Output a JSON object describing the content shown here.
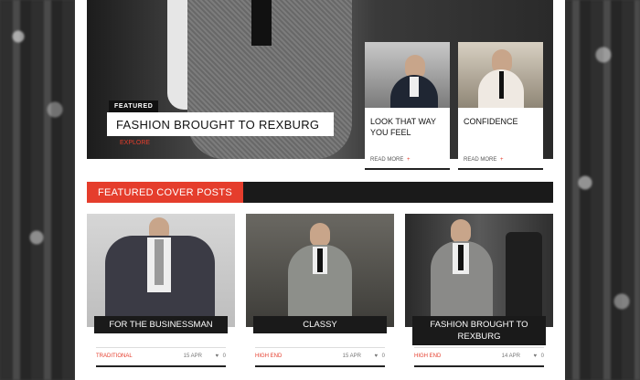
{
  "hero": {
    "badge": "FEATURED",
    "title": "FASHION BROUGHT TO REXBURG",
    "link": "EXPLORE"
  },
  "side_cards": [
    {
      "title": "LOOK THAT WAY YOU FEEL",
      "read_more": "READ MORE",
      "plus": "+"
    },
    {
      "title": "CONFIDENCE",
      "read_more": "READ MORE",
      "plus": "+"
    }
  ],
  "section": {
    "heading": "FEATURED COVER POSTS"
  },
  "posts": [
    {
      "title": "FOR THE BUSINESSMAN",
      "category": "TRADITIONAL",
      "date": "15 APR",
      "comments": "0"
    },
    {
      "title": "CLASSY",
      "category": "HIGH END",
      "date": "15 APR",
      "comments": "0"
    },
    {
      "title": "FASHION BROUGHT TO REXBURG",
      "category": "HIGH END",
      "date": "14 APR",
      "comments": "0"
    }
  ],
  "colors": {
    "accent": "#e53d2c",
    "dark": "#1a1a1a"
  },
  "icons": {
    "comment": "heart-icon"
  }
}
